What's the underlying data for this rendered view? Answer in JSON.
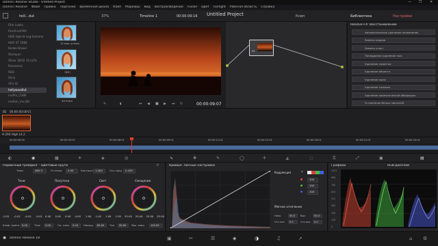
{
  "window": {
    "title": "DaVinci Resolve Studio - Untitled Project",
    "controls": [
      "—",
      "❐",
      "✕"
    ]
  },
  "menubar": {
    "items": [
      "DaVinci Resolve",
      "Файл",
      "Правка",
      "Подгонка",
      "Временная шкала",
      "Клип",
      "Маркеры",
      "Вид",
      "Воспроизведение",
      "Fusion",
      "Цвет",
      "Fairlight",
      "Рабочая область",
      "Справка"
    ]
  },
  "toolbar": {
    "media_label": "holl...dut",
    "zoom": "37%",
    "timeline_label": "Timeline 1",
    "timecode": "00:00:09:16",
    "project_title": "Untitled Project",
    "clip_label": "Клип",
    "library_tab": "Библиотека",
    "inspector_tab": "Настройки"
  },
  "luts": {
    "items": [
      "Film Looks",
      "FilmPrintFMV",
      "HDR Hybrid Log-Gamma",
      "HDR ST 2084",
      "Kodak Brown",
      "Olympus",
      "Other 3D32 10 LUTs",
      "Panasonic",
      "RED",
      "Sony",
      "VFX IO",
      "hollywoodlut",
      "mvPro_CUBE",
      "motion_mv.dat"
    ],
    "selected_index": 11,
    "thumbs": [
      "12 teen a from",
      "ЧЕУ!",
      "4d mora"
    ]
  },
  "viewer": {
    "timecode": "00:00:09:07"
  },
  "nodes": {
    "node_label": "01"
  },
  "fx": {
    "header": "Resolve FX: Восстановление",
    "items": [
      "Автоматическое удаление затемнения",
      "Замена кадров",
      "Замена участ.",
      "Понаддания удаление пыл.",
      "Удаление засветки",
      "Удаление объекта",
      "Удаление пыли",
      "Удаление хлопьев",
      "Удаление хроматической аберрации",
      "Устранение белых пикселей"
    ]
  },
  "clips": {
    "clip_number": "01",
    "clip_tc": "00:00:00:00",
    "clip_track": "V1",
    "codec": "H.264 High L4.2"
  },
  "timeline": {
    "ruler_labels": [
      "00:00:00:00",
      "00:00:03:01",
      "00:00:06:01",
      "00:00:09:01",
      "00:00:12:01",
      "00:00:15:01",
      "00:00:18:01",
      "00:00:21:01",
      "00:00:24:01"
    ],
    "playhead_fraction": 0.3
  },
  "primaries": {
    "title": "Первичный грейдинг - Цветовые круги",
    "top_params": [
      {
        "label": "Темп",
        "value": "460.0"
      },
      {
        "label": "Оттенок",
        "value": "0.00"
      },
      {
        "label": "Контраст",
        "value": "1.000"
      },
      {
        "label": "Ось сред",
        "value": "0.435"
      }
    ],
    "wheels": [
      {
        "label": "Тени",
        "values": [
          "-0.01",
          "-0.01",
          "-0.01",
          "-0.01"
        ]
      },
      {
        "label": "Полутона",
        "values": [
          "0.00",
          "0.00",
          "0.00",
          "0.00"
        ]
      },
      {
        "label": "Свет",
        "values": [
          "1.00",
          "1.00",
          "1.00",
          "1.00"
        ]
      },
      {
        "label": "Смещение",
        "values": [
          "25.00",
          "25.00",
          "25.00",
          "25.00"
        ]
      }
    ],
    "bottom_params": [
      {
        "label": "Коэф. цвета",
        "value": "0.00"
      },
      {
        "label": "Тень",
        "value": "0.00"
      },
      {
        "label": "Св. тоны",
        "value": "0.00"
      },
      {
        "label": "Насыщ.",
        "value": "85.00"
      },
      {
        "label": "Тон",
        "value": "50.00"
      },
      {
        "label": "Ярк. микс",
        "value": "100.00"
      }
    ]
  },
  "curves": {
    "title": "Кривые: Личные настройки",
    "correction_label": "Коррекция",
    "channels": [
      {
        "color": "#e04040",
        "value": "100"
      },
      {
        "color": "#40c040",
        "value": "100"
      },
      {
        "color": "#4060e0",
        "value": "100"
      }
    ],
    "soft_clip_label": "Мягкое отсечение",
    "soft_clip": [
      {
        "label": "Низк.",
        "value": "50.0"
      },
      {
        "label": "Выс.",
        "value": "50.0"
      },
      {
        "label": "Отс.низ",
        "value": "0.0"
      },
      {
        "label": "Отс.выс",
        "value": "0.0"
      }
    ]
  },
  "scopes": {
    "title": "Графики",
    "mode": "RGB-дисплей",
    "scale": [
      "1023",
      "896",
      "768",
      "640",
      "512",
      "384",
      "256",
      "128",
      "0"
    ]
  },
  "bottombar": {
    "app_label": "DaVinci Resolve 18"
  }
}
